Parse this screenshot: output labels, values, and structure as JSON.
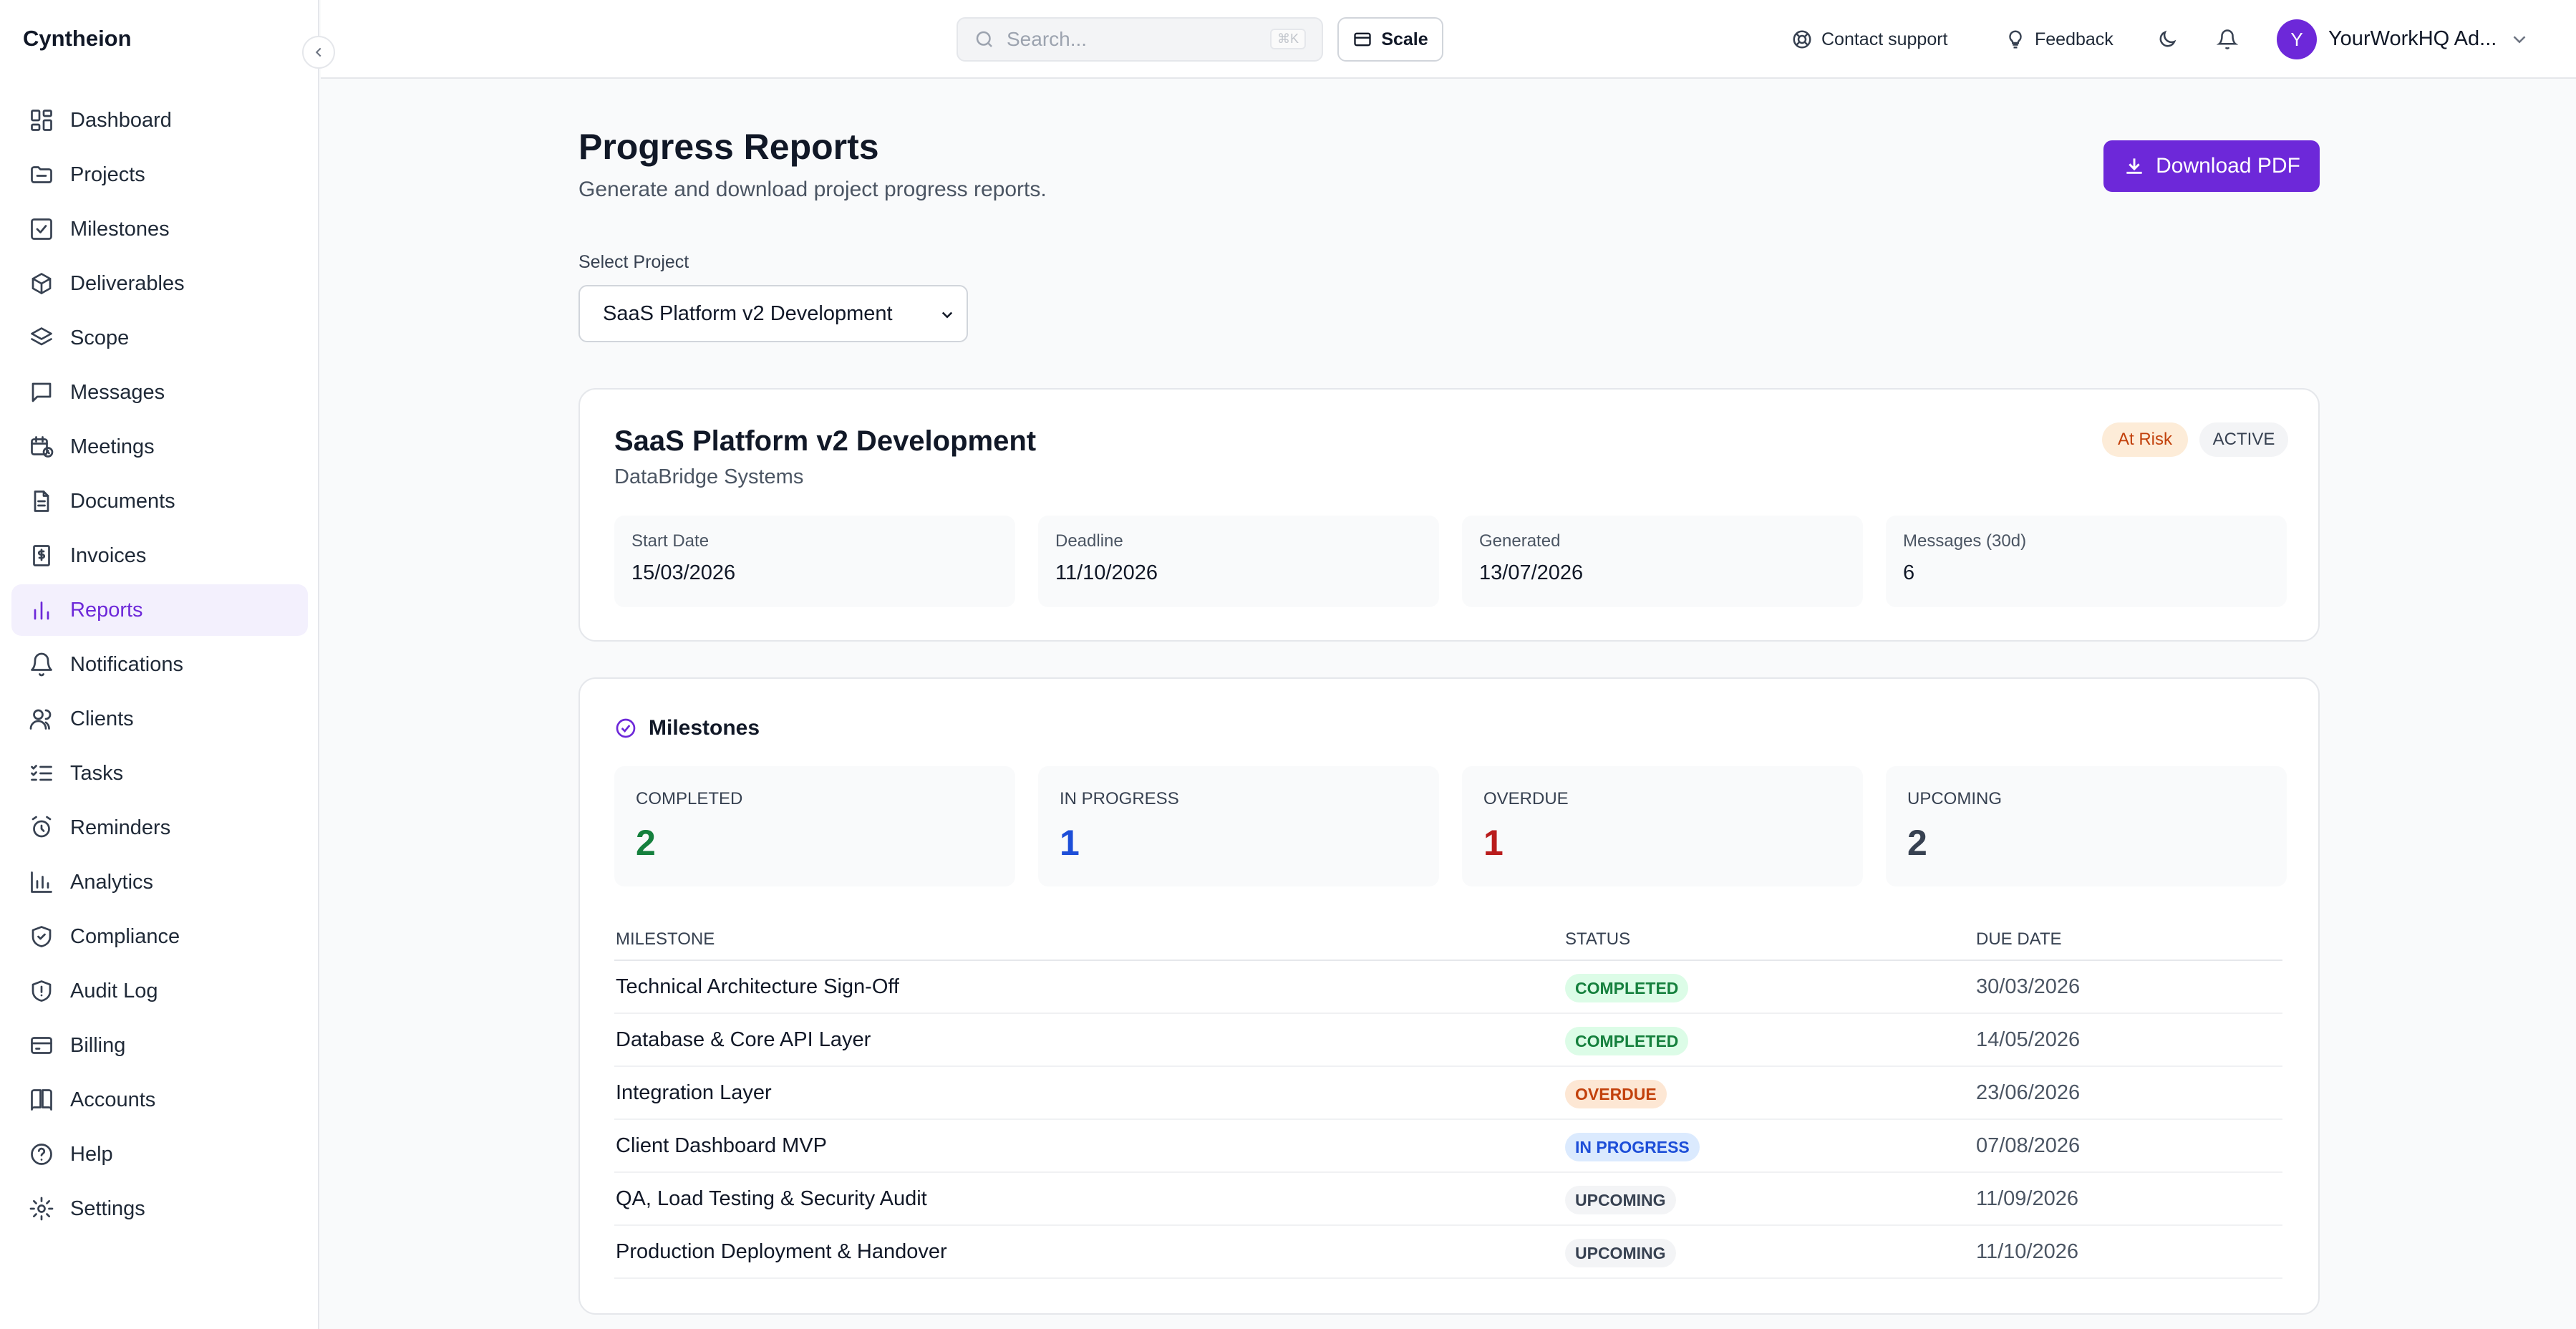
{
  "app": {
    "brand": "Cyntheion"
  },
  "sidebar": {
    "items": [
      {
        "label": "Dashboard",
        "icon": "dashboard-icon"
      },
      {
        "label": "Projects",
        "icon": "folder-icon"
      },
      {
        "label": "Milestones",
        "icon": "checkbox-icon"
      },
      {
        "label": "Deliverables",
        "icon": "package-icon"
      },
      {
        "label": "Scope",
        "icon": "layers-icon"
      },
      {
        "label": "Messages",
        "icon": "message-icon"
      },
      {
        "label": "Meetings",
        "icon": "calendar-clock-icon"
      },
      {
        "label": "Documents",
        "icon": "document-icon"
      },
      {
        "label": "Invoices",
        "icon": "invoice-icon"
      },
      {
        "label": "Reports",
        "icon": "bar-chart-icon"
      },
      {
        "label": "Notifications",
        "icon": "bell-icon"
      },
      {
        "label": "Clients",
        "icon": "users-icon"
      },
      {
        "label": "Tasks",
        "icon": "list-checks-icon"
      },
      {
        "label": "Reminders",
        "icon": "alarm-clock-icon"
      },
      {
        "label": "Analytics",
        "icon": "analytics-icon"
      },
      {
        "label": "Compliance",
        "icon": "shield-check-icon"
      },
      {
        "label": "Audit Log",
        "icon": "shield-alert-icon"
      },
      {
        "label": "Billing",
        "icon": "credit-card-icon"
      },
      {
        "label": "Accounts",
        "icon": "book-icon"
      },
      {
        "label": "Help",
        "icon": "help-circle-icon"
      },
      {
        "label": "Settings",
        "icon": "gear-icon"
      }
    ],
    "active_index": 9
  },
  "topbar": {
    "search_placeholder": "Search...",
    "search_shortcut": "⌘K",
    "scale_label": "Scale",
    "contact_label": "Contact support",
    "feedback_label": "Feedback",
    "user_initial": "Y",
    "user_name": "YourWorkHQ Ad..."
  },
  "page": {
    "title": "Progress Reports",
    "subtitle": "Generate and download project progress reports.",
    "download_label": "Download PDF",
    "select_label": "Select Project",
    "select_value": "SaaS Platform v2 Development"
  },
  "project": {
    "name": "SaaS Platform v2 Development",
    "client": "DataBridge Systems",
    "risk_badge": "At Risk",
    "status_badge": "ACTIVE",
    "info": [
      {
        "label": "Start Date",
        "value": "15/03/2026"
      },
      {
        "label": "Deadline",
        "value": "11/10/2026"
      },
      {
        "label": "Generated",
        "value": "13/07/2026"
      },
      {
        "label": "Messages (30d)",
        "value": "6"
      }
    ]
  },
  "milestones": {
    "heading": "Milestones",
    "stats": [
      {
        "label": "COMPLETED",
        "value": "2",
        "color": "#15803d"
      },
      {
        "label": "IN PROGRESS",
        "value": "1",
        "color": "#1d4ed8"
      },
      {
        "label": "OVERDUE",
        "value": "1",
        "color": "#b91c1c"
      },
      {
        "label": "UPCOMING",
        "value": "2",
        "color": "#374151"
      }
    ],
    "columns": {
      "name": "MILESTONE",
      "status": "STATUS",
      "due": "DUE DATE"
    },
    "rows": [
      {
        "name": "Technical Architecture Sign-Off",
        "status": "COMPLETED",
        "due": "30/03/2026"
      },
      {
        "name": "Database & Core API Layer",
        "status": "COMPLETED",
        "due": "14/05/2026"
      },
      {
        "name": "Integration Layer",
        "status": "OVERDUE",
        "due": "23/06/2026"
      },
      {
        "name": "Client Dashboard MVP",
        "status": "IN PROGRESS",
        "due": "07/08/2026"
      },
      {
        "name": "QA, Load Testing & Security Audit",
        "status": "UPCOMING",
        "due": "11/09/2026"
      },
      {
        "name": "Production Deployment & Handover",
        "status": "UPCOMING",
        "due": "11/10/2026"
      }
    ],
    "status_colors": {
      "COMPLETED": {
        "bg": "#dcfce7",
        "fg": "#15803d"
      },
      "OVERDUE": {
        "bg": "#fde7d4",
        "fg": "#c2410c"
      },
      "IN PROGRESS": {
        "bg": "#dbeafe",
        "fg": "#1d4ed8"
      },
      "UPCOMING": {
        "bg": "#f3f4f6",
        "fg": "#374151"
      }
    }
  },
  "colors": {
    "accent": "#6d28d9",
    "active_bg": "#f3f0fd"
  }
}
